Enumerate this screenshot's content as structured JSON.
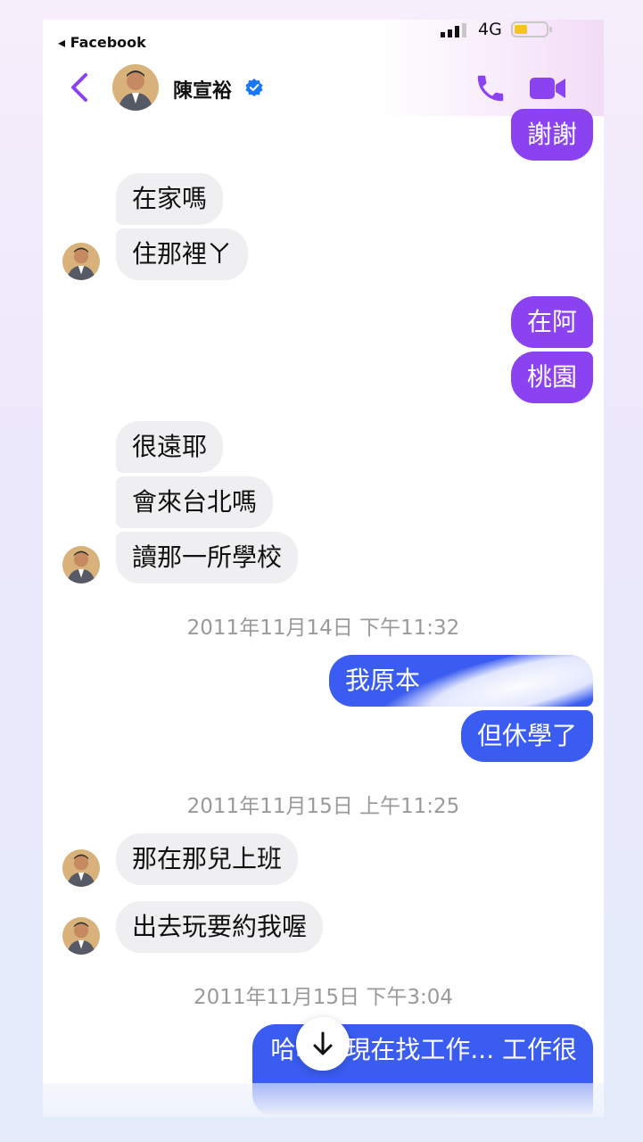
{
  "status_bar": {
    "back_app_label": "◂ Facebook",
    "network": "4G"
  },
  "header": {
    "contact_name": "陳宣裕",
    "accent_color": "#8b43f2"
  },
  "messages": [
    {
      "text": "謝謝",
      "dir": "out"
    },
    {
      "text": "在家嗎",
      "dir": "in"
    },
    {
      "text": "住那裡ㄚ",
      "dir": "in"
    },
    {
      "text": "在阿",
      "dir": "out"
    },
    {
      "text": "桃園",
      "dir": "out"
    },
    {
      "text": "很遠耶",
      "dir": "in"
    },
    {
      "text": "會來台北嗎",
      "dir": "in"
    },
    {
      "text": "讀那一所學校",
      "dir": "in"
    },
    {
      "text": "我原本",
      "dir": "out"
    },
    {
      "text": "但休學了",
      "dir": "out"
    },
    {
      "text": "那在那兒上班",
      "dir": "in"
    },
    {
      "text": "出去玩要約我喔",
      "dir": "in"
    },
    {
      "text": "哈哈我現在找工作... 工作很",
      "dir": "out"
    }
  ],
  "timestamps": [
    "2011年11月14日 下午11:32",
    "2011年11月15日 上午11:25",
    "2011年11月15日 下午3:04"
  ]
}
